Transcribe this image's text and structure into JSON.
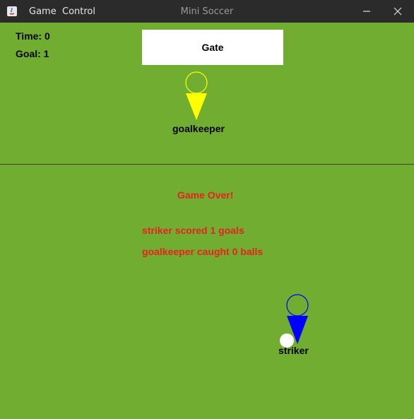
{
  "window": {
    "title": "Mini Soccer",
    "menu": [
      "Game",
      "Control"
    ],
    "icons": {
      "app": "java-app-icon",
      "minimize": "minimize-icon",
      "close": "close-icon"
    }
  },
  "hud": {
    "time": "Time: 0",
    "goal": "Goal: 1"
  },
  "gate": {
    "label": "Gate"
  },
  "players": {
    "goalkeeper": {
      "label": "goalkeeper",
      "color": "#ffff00"
    },
    "striker": {
      "label": "striker",
      "color": "#0000ff"
    }
  },
  "ball": {
    "color": "#ffffff"
  },
  "messages": {
    "game_over": "Game Over!",
    "striker_score": "striker scored 1 goals",
    "keeper_score": "goalkeeper caught 0 balls"
  },
  "colors": {
    "field": "#70ad30",
    "message": "#e8221e",
    "titlebar": "#2b2b2b"
  }
}
